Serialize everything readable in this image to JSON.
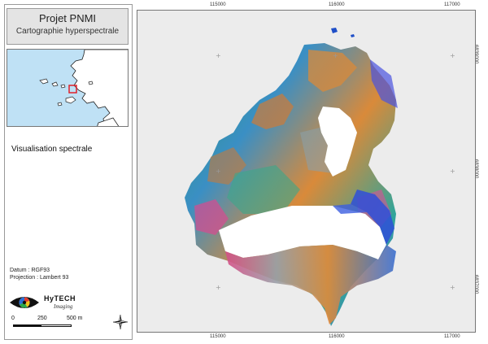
{
  "title": {
    "main": "Projet PNMI",
    "sub": "Cartographie hyperspectrale"
  },
  "layer_label": "Visualisation spectrale",
  "datum": {
    "line1": "Datum : RGF93",
    "line2": "Projection : Lambert 93"
  },
  "brand": {
    "name": "HyTECH",
    "tagline": "Imaging"
  },
  "scale_bar": {
    "labels": [
      "0",
      "250",
      "500 m"
    ]
  },
  "grid": {
    "x_labels": [
      "115000",
      "116000",
      "117000"
    ],
    "y_labels": [
      "6839000",
      "6838000",
      "6837000"
    ]
  },
  "colors": {
    "sea_inset": "#bfe1f5",
    "land_inset": "#ffffff",
    "map_background": "#ececec",
    "marker": "#e0202a"
  },
  "icons": {
    "logo": "eye-logo-icon",
    "north": "north-arrow-icon"
  }
}
